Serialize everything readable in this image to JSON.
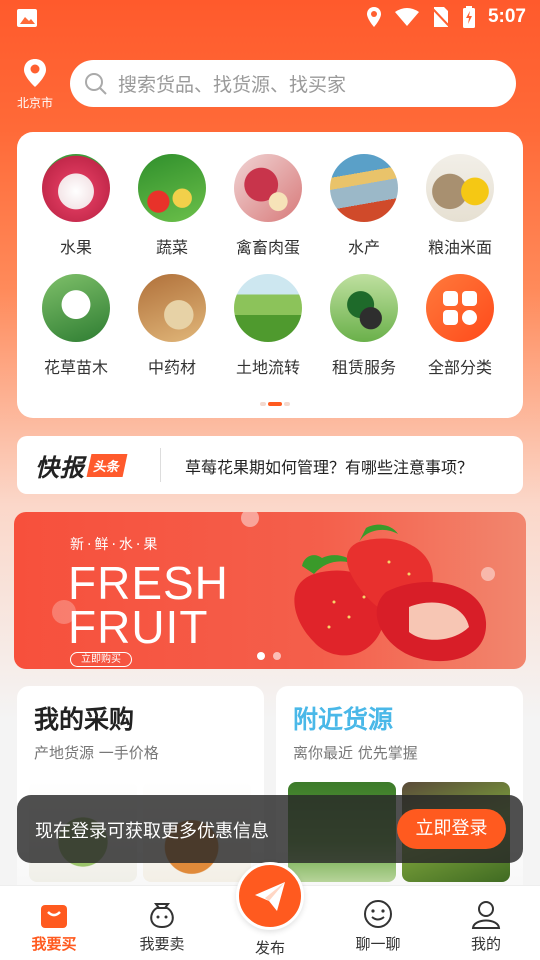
{
  "status_bar": {
    "time": "5:07"
  },
  "header": {
    "location": "北京市",
    "search_placeholder": "搜索货品、找货源、找买家"
  },
  "categories": [
    {
      "label": "水果",
      "icon": "lychee-icon"
    },
    {
      "label": "蔬菜",
      "icon": "vegetables-icon"
    },
    {
      "label": "禽畜肉蛋",
      "icon": "meat-egg-icon"
    },
    {
      "label": "水产",
      "icon": "fish-icon"
    },
    {
      "label": "粮油米面",
      "icon": "grain-oil-icon"
    },
    {
      "label": "花草苗木",
      "icon": "flower-icon"
    },
    {
      "label": "中药材",
      "icon": "herb-icon"
    },
    {
      "label": "土地流转",
      "icon": "land-icon"
    },
    {
      "label": "租赁服务",
      "icon": "tractor-icon"
    },
    {
      "label": "全部分类",
      "icon": "all-categories-icon"
    }
  ],
  "news": {
    "brand": "快报",
    "tag": "头条",
    "headline": "草莓花果期如何管理？有哪些注意事项？"
  },
  "banner": {
    "small_text": "新·鲜·水·果",
    "line1": "FRESH",
    "line2": "FRUIT",
    "button": "立即购买"
  },
  "cards": {
    "purchase": {
      "title": "我的采购",
      "subtitle": "产地货源  一手价格"
    },
    "nearby": {
      "title": "附近货源",
      "subtitle": "离你最近  优先掌握"
    }
  },
  "toast": {
    "message": "现在登录可获取更多优惠信息",
    "button": "立即登录"
  },
  "tabbar": {
    "buy": "我要买",
    "sell": "我要卖",
    "publish": "发布",
    "chat": "聊一聊",
    "mine": "我的"
  },
  "colors": {
    "accent": "#ff5a1f",
    "nearby_title": "#4ab8e8"
  }
}
